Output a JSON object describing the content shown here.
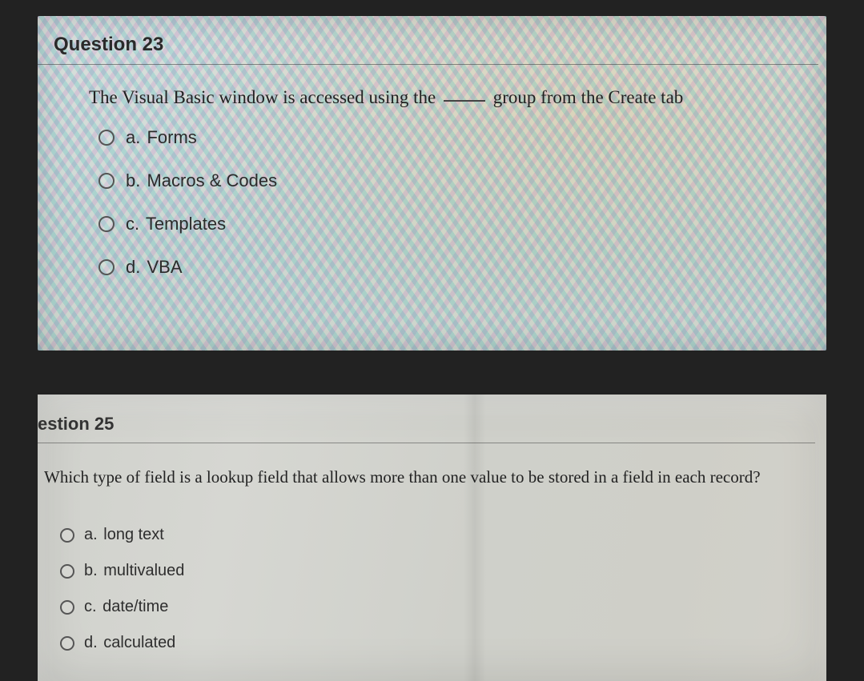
{
  "q1": {
    "heading": "Question 23",
    "prompt_pre": "The Visual Basic window is accessed using the",
    "prompt_post": "group from the Create tab",
    "options": [
      {
        "letter": "a.",
        "text": "Forms"
      },
      {
        "letter": "b.",
        "text": "Macros & Codes"
      },
      {
        "letter": "c.",
        "text": "Templates"
      },
      {
        "letter": "d.",
        "text": "VBA"
      }
    ]
  },
  "q2": {
    "heading": "estion 25",
    "prompt": "Which type of field is a lookup field that allows more than one value to be stored in a field in each record?",
    "options": [
      {
        "letter": "a.",
        "text": "long text"
      },
      {
        "letter": "b.",
        "text": "multivalued"
      },
      {
        "letter": "c.",
        "text": "date/time"
      },
      {
        "letter": "d.",
        "text": "calculated"
      }
    ]
  }
}
